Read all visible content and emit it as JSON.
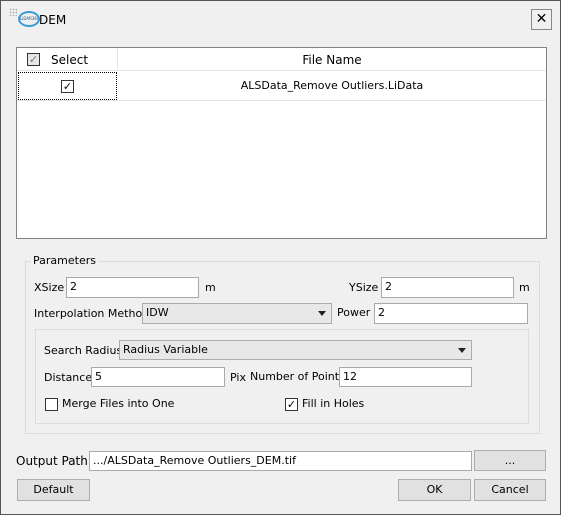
{
  "window": {
    "title": "DEM",
    "logo_text": "LiDAR360",
    "close_icon": "close-icon"
  },
  "table": {
    "columns": [
      "Select",
      "File Name"
    ],
    "header_checked": true,
    "rows": [
      {
        "checked": true,
        "file_name": "ALSData_Remove Outliers.LiData"
      }
    ]
  },
  "parameters": {
    "group_label": "Parameters",
    "xsize_label": "XSize",
    "xsize_value": "2",
    "xsize_unit": "m",
    "ysize_label": "YSize",
    "ysize_value": "2",
    "ysize_unit": "m",
    "interp_label": "Interpolation Method",
    "interp_value": "IDW",
    "power_label": "Power",
    "power_value": "2",
    "search_radius_label": "Search Radius",
    "search_radius_value": "Radius Variable",
    "distance_label": "Distance",
    "distance_value": "5",
    "distance_unit": "Pix",
    "num_points_label": "Number of Points",
    "num_points_value": "12",
    "merge_label": "Merge Files into One",
    "merge_checked": false,
    "fill_label": "Fill in Holes",
    "fill_checked": true
  },
  "output": {
    "label": "Output Path:",
    "value": ".../ALSData_Remove Outliers_DEM.tif",
    "browse_label": "..."
  },
  "buttons": {
    "default": "Default",
    "ok": "OK",
    "cancel": "Cancel"
  }
}
